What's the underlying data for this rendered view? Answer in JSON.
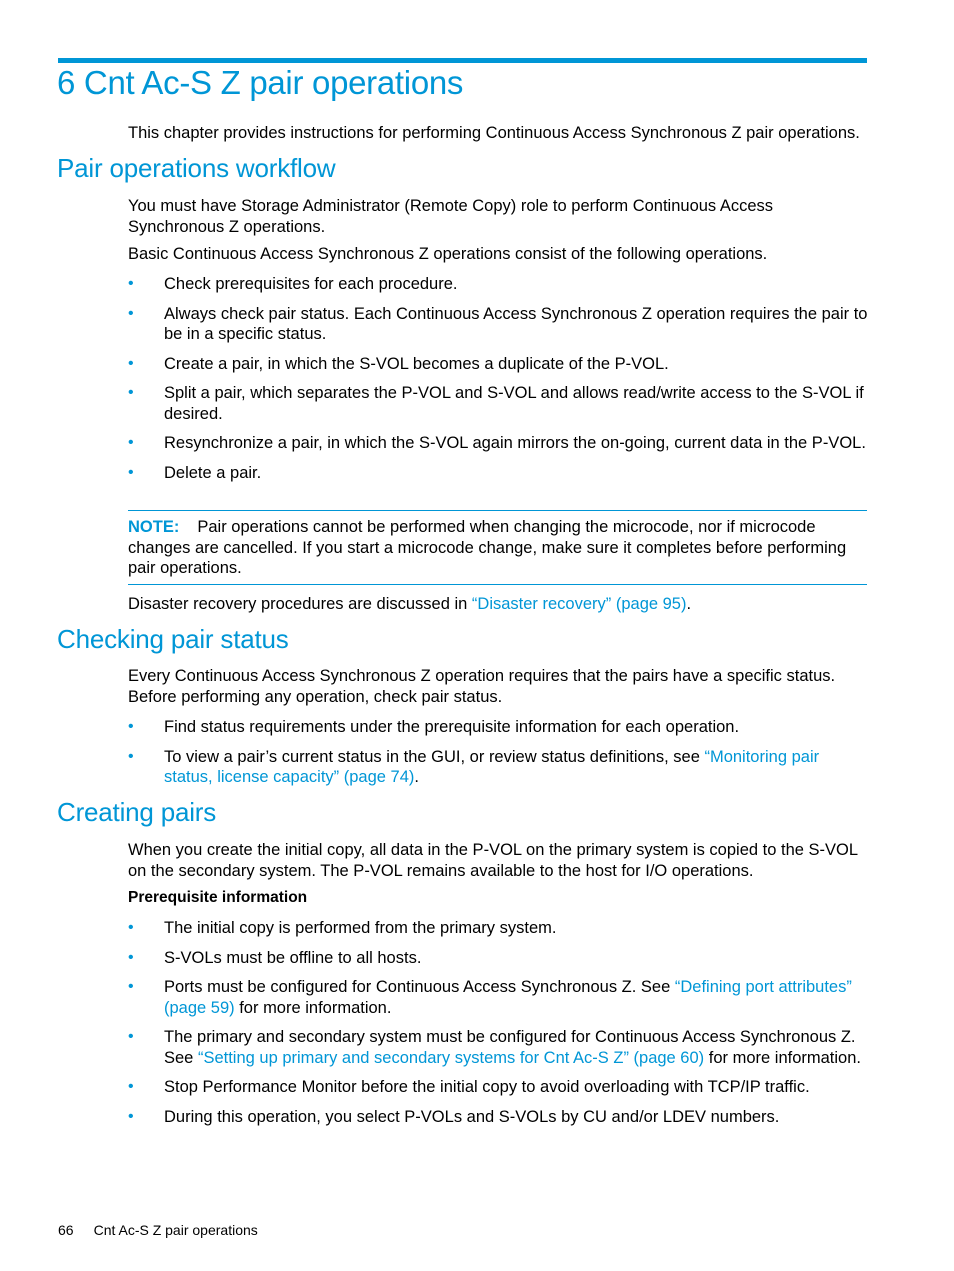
{
  "chapter": {
    "title": "6 Cnt Ac-S Z pair operations",
    "intro": "This chapter provides instructions for performing Continuous Access Synchronous Z pair operations."
  },
  "workflow": {
    "heading": "Pair operations workflow",
    "p1": "You must have Storage Administrator (Remote Copy) role to perform Continuous Access Synchronous Z operations.",
    "p2": "Basic Continuous Access Synchronous Z operations consist of the following operations.",
    "bullets": [
      "Check prerequisites for each procedure.",
      "Always check pair status. Each Continuous Access Synchronous Z operation requires the pair to be in a specific status.",
      "Create a pair, in which the S-VOL becomes a duplicate of the P-VOL.",
      "Split a pair, which separates the P-VOL and S-VOL and allows read/write access to the S-VOL if desired.",
      "Resynchronize a pair, in which the S-VOL again mirrors the on-going, current data in the P-VOL.",
      "Delete a pair."
    ],
    "note_label": "NOTE:",
    "note_text": "Pair operations cannot be performed when changing the microcode, nor if microcode changes are cancelled. If you start a microcode change, make sure it completes before performing pair operations.",
    "disaster_pre": "Disaster recovery procedures are discussed in ",
    "disaster_link": "“Disaster recovery” (page 95)",
    "disaster_post": "."
  },
  "checking": {
    "heading": "Checking pair status",
    "p1": "Every Continuous Access Synchronous Z operation requires that the pairs have a specific status. Before performing any operation, check pair status.",
    "bullet1": "Find status requirements under the prerequisite information for each operation.",
    "bullet2_pre": "To view a pair’s current status in the GUI, or review status definitions, see ",
    "bullet2_link": "“Monitoring pair status, license capacity” (page 74)",
    "bullet2_post": "."
  },
  "creating": {
    "heading": "Creating pairs",
    "p1": "When you create the initial copy, all data in the P-VOL on the primary system is copied to the S-VOL on the secondary system. The P-VOL remains available to the host for I/O operations.",
    "prereq_heading": "Prerequisite information",
    "b1": "The initial copy is performed from the primary system.",
    "b2": "S-VOLs must be offline to all hosts.",
    "b3_pre": "Ports must be configured for Continuous Access Synchronous Z. See ",
    "b3_link": "“Defining port attributes” (page 59)",
    "b3_post": " for more information.",
    "b4_pre": "The primary and secondary system must be configured for Continuous Access Synchronous Z. See ",
    "b4_link": "“Setting up primary and secondary systems for Cnt Ac-S Z” (page 60)",
    "b4_post": " for more information.",
    "b5": "Stop Performance Monitor before the initial copy to avoid overloading with TCP/IP traffic.",
    "b6": "During this operation, you select P-VOLs and S-VOLs by CU and/or LDEV numbers."
  },
  "footer": {
    "page_number": "66",
    "section": "Cnt Ac-S Z pair operations"
  },
  "bullet_glyph": "•"
}
